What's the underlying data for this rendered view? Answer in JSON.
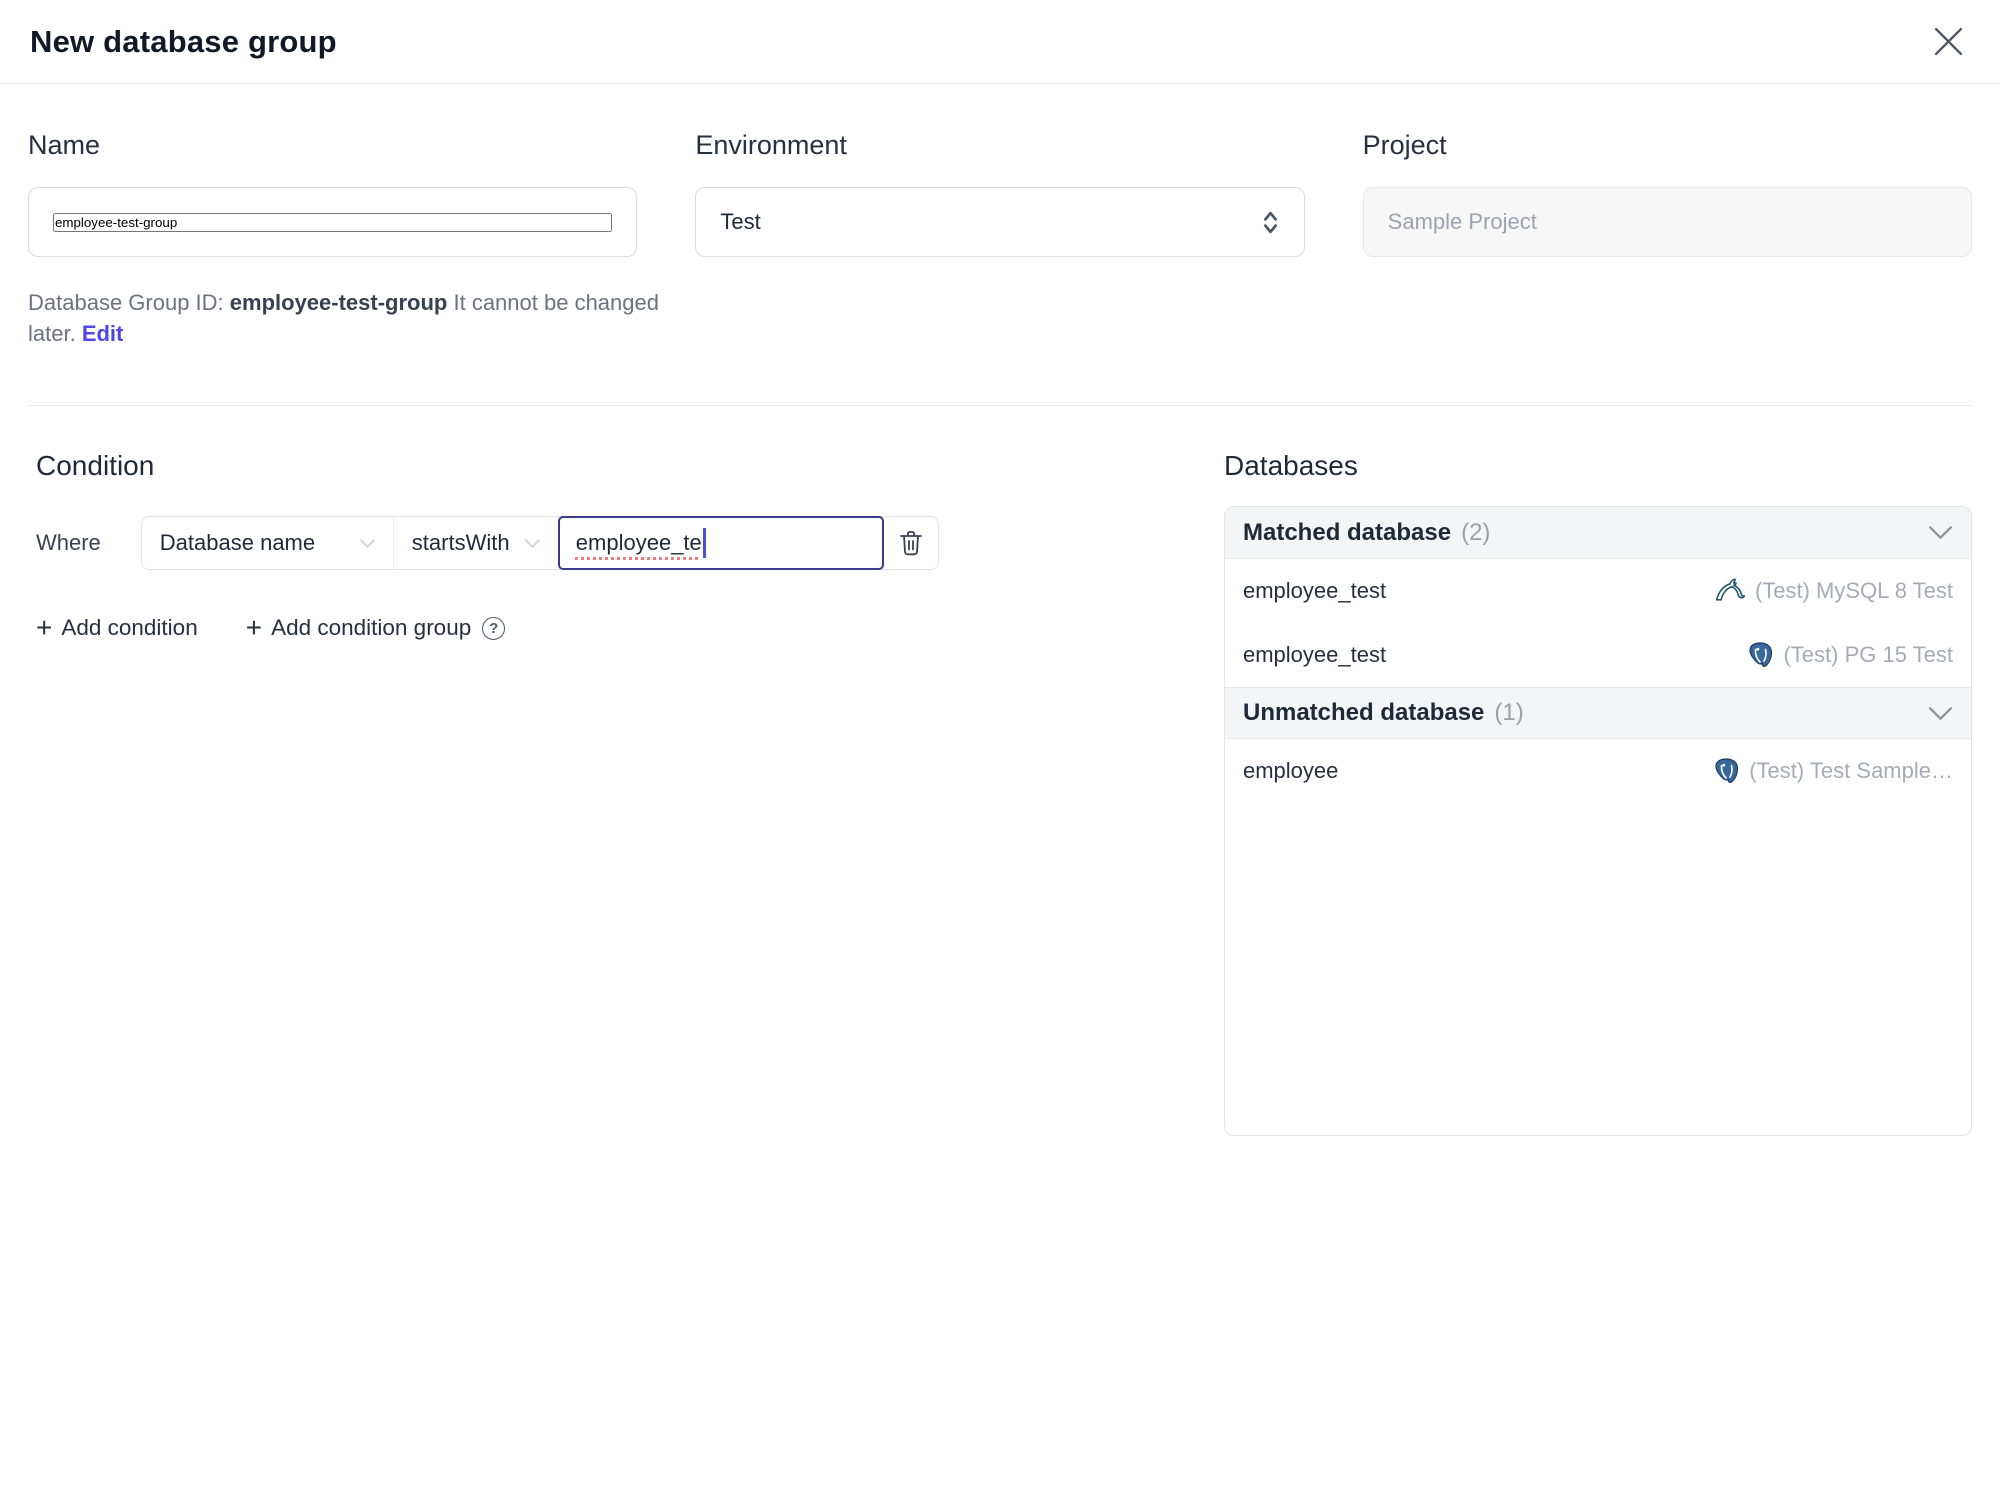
{
  "dialog": {
    "title": "New database group"
  },
  "form": {
    "name": {
      "label": "Name",
      "value": "employee-test-group"
    },
    "environment": {
      "label": "Environment",
      "value": "Test"
    },
    "project": {
      "label": "Project",
      "value": "Sample Project"
    },
    "id_note": {
      "prefix": "Database Group ID: ",
      "id": "employee-test-group",
      "suffix": " It cannot be changed later. ",
      "edit_label": "Edit"
    }
  },
  "condition": {
    "heading": "Condition",
    "where_label": "Where",
    "factor": "Database name",
    "operator": "startsWith",
    "value": "employee_te",
    "add_condition": "Add condition",
    "add_condition_group": "Add condition group",
    "plus_glyph": "+",
    "help_glyph": "?"
  },
  "databases": {
    "heading": "Databases",
    "matched": {
      "label": "Matched database",
      "count": "(2)"
    },
    "unmatched": {
      "label": "Unmatched database",
      "count": "(1)"
    },
    "matched_rows": [
      {
        "name": "employee_test",
        "icon": "mysql-icon",
        "instance": "(Test) MySQL 8 Test"
      },
      {
        "name": "employee_test",
        "icon": "postgres-icon",
        "instance": "(Test) PG 15 Test"
      }
    ],
    "unmatched_rows": [
      {
        "name": "employee",
        "icon": "postgres-icon",
        "instance": "(Test) Test Sample…"
      }
    ]
  },
  "colors": {
    "accent": "#4f46e5",
    "focus_border": "#3d3a8c",
    "mysql_brand": "#255a72",
    "postgres_brand": "#38689b",
    "header_bg": "#f4f5f6",
    "border": "#e3e4e8"
  }
}
